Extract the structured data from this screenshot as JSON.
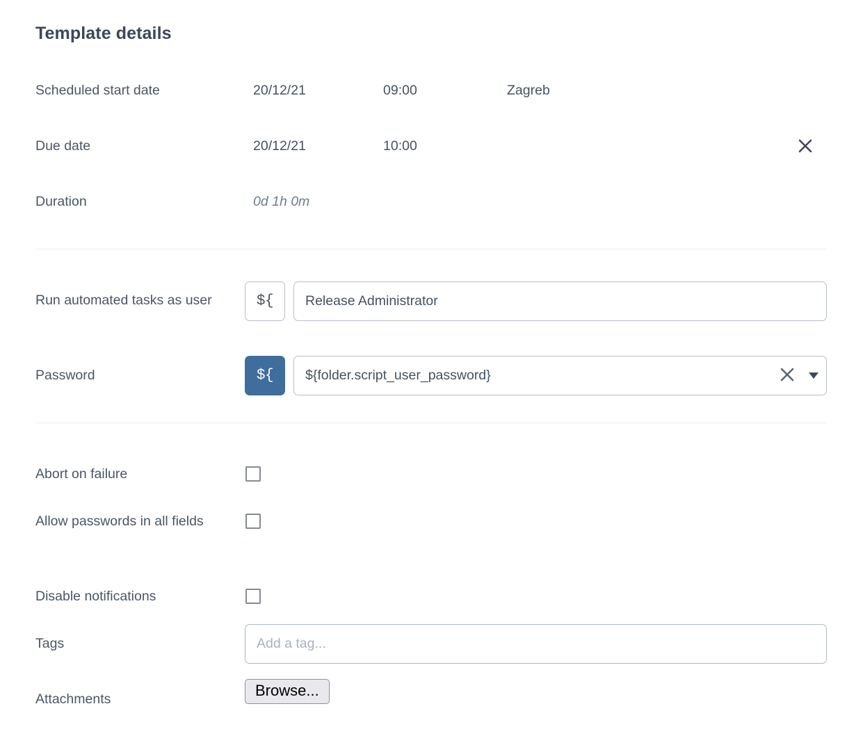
{
  "header": {
    "title": "Template details"
  },
  "schedule": {
    "start": {
      "label": "Scheduled start date",
      "date": "20/12/21",
      "time": "09:00",
      "timezone": "Zagreb"
    },
    "due": {
      "label": "Due date",
      "date": "20/12/21",
      "time": "10:00",
      "clear_icon": "close-x-icon"
    },
    "duration": {
      "label": "Duration",
      "value": "0d 1h 0m"
    }
  },
  "automation": {
    "run_as_user": {
      "label": "Run automated tasks as user",
      "variable_button": "${",
      "value": "Release Administrator",
      "placeholder": ""
    },
    "password": {
      "label": "Password",
      "variable_button": "${",
      "variable_button_active": true,
      "value": "${folder.script_user_password}",
      "placeholder": "",
      "clear_icon": "close-x-icon",
      "dropdown_icon": "chevron-down-icon"
    }
  },
  "options": {
    "abort_on_failure": {
      "label": "Abort on failure",
      "checked": false
    },
    "allow_passwords": {
      "label": "Allow passwords in all fields",
      "checked": false
    },
    "disable_notifications": {
      "label": "Disable notifications",
      "checked": false
    },
    "tags": {
      "label": "Tags",
      "value": "",
      "placeholder": "Add a tag..."
    },
    "attachments": {
      "label": "Attachments",
      "browse_label": "Browse..."
    }
  },
  "colors": {
    "accent_blue": "#3f6e9c",
    "text_dark": "#3b4858",
    "label_text": "#4a5666",
    "muted_text": "#6f7d8c",
    "placeholder": "#a8b2bd",
    "border": "#b7bfc9",
    "divider": "#e9ecef",
    "button_face": "#e9e9ed"
  }
}
